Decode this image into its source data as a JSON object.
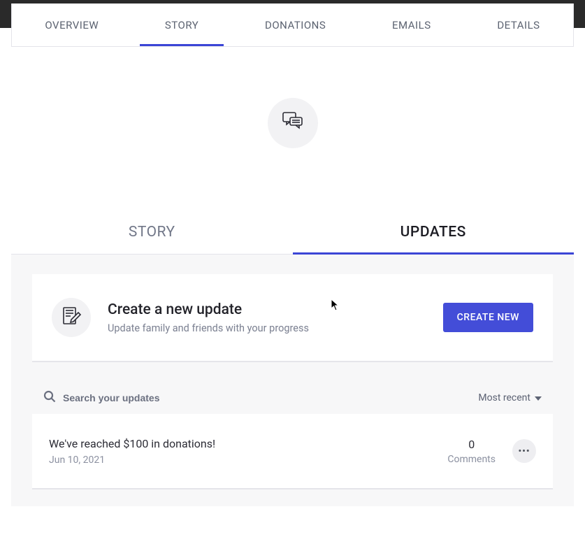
{
  "top_tabs": {
    "overview": "OVERVIEW",
    "story": "STORY",
    "donations": "DONATIONS",
    "emails": "EMAILS",
    "details": "DETAILS"
  },
  "sub_tabs": {
    "story": "STORY",
    "updates": "UPDATES"
  },
  "create_update": {
    "title": "Create a new update",
    "subtitle": "Update family and friends with your progress",
    "button": "CREATE NEW"
  },
  "search": {
    "placeholder": "Search your updates"
  },
  "sort": {
    "label": "Most recent"
  },
  "updates": [
    {
      "title": "We've reached $100 in donations!",
      "date": "Jun 10, 2021",
      "comments_count": "0",
      "comments_label": "Comments"
    }
  ]
}
